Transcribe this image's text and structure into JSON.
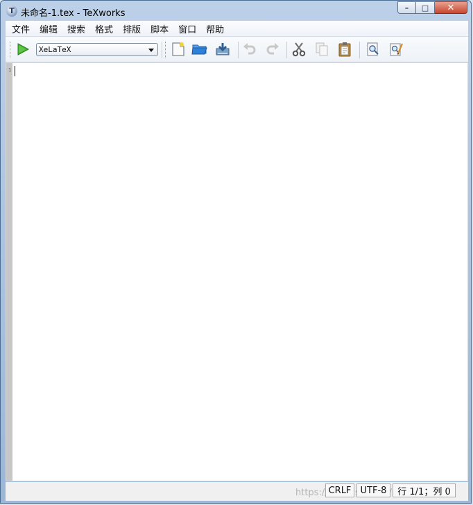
{
  "window": {
    "title": "未命名-1.tex - TeXworks",
    "app_icon_glyph": "T",
    "controls": {
      "minimize": "–",
      "maximize": "□",
      "close": "✕"
    }
  },
  "menu": {
    "items": [
      "文件",
      "编辑",
      "搜索",
      "格式",
      "排版",
      "脚本",
      "窗口",
      "帮助"
    ]
  },
  "toolbar": {
    "typeset_icon": "play-icon",
    "engine": "XeLaTeX",
    "icons": [
      "new-document-icon",
      "open-folder-icon",
      "save-icon",
      "undo-icon",
      "redo-icon",
      "cut-icon",
      "copy-icon",
      "paste-icon",
      "find-icon",
      "replace-icon"
    ]
  },
  "editor": {
    "content": "",
    "gutter_marker": "1"
  },
  "status": {
    "line_ending": "CRLF",
    "encoding": "UTF-8",
    "position": "行 1/1；列 0",
    "watermark": "https://blog.csdn.net/sde"
  },
  "colors": {
    "window_frame": "#bcd0e8",
    "toolbar_bg": "#f9fbfd",
    "editor_bg": "#ffffff",
    "gutter_bg": "#c7c7c7",
    "play_green": "#43b52f",
    "folder_blue": "#2f80d8",
    "paste_brown": "#b98a3d"
  }
}
